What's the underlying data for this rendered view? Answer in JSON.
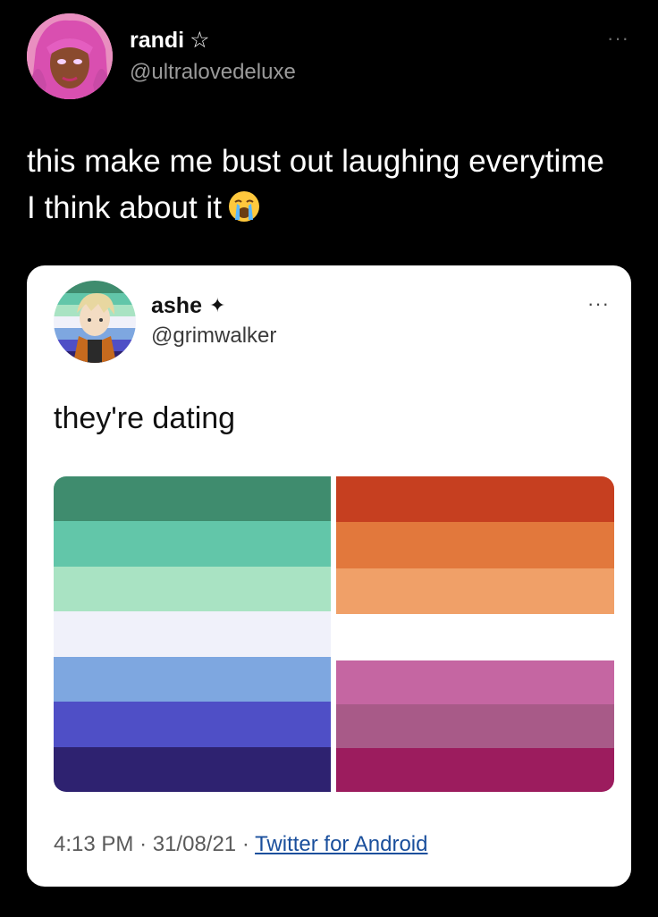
{
  "outer_tweet": {
    "display_name": "randi",
    "name_icon": "star-outline-icon",
    "handle": "@ultralovedeluxe",
    "more_icon": "more-horizontal-icon",
    "more_glyph": "···",
    "text": "this make me bust out laughing everytime I think about it",
    "emoji_icon": "loudly-crying-face-icon"
  },
  "quoted_tweet": {
    "display_name": "ashe",
    "name_icon": "sparkle-icon",
    "handle": "@grimwalker",
    "more_icon": "more-horizontal-icon",
    "more_glyph": "···",
    "text": "they're dating",
    "image": {
      "left_flag_stripes": [
        "#3f8c6e",
        "#62c6a9",
        "#a9e3c3",
        "#f0f1fa",
        "#7ea7e0",
        "#4f4fc6",
        "#2e2270"
      ],
      "right_flag_top_stripes": [
        "#c63f20",
        "#e2783c",
        "#f0a068"
      ],
      "right_flag_bottom_stripes": [
        "#c566a2",
        "#a85a88",
        "#9c1c5e"
      ]
    },
    "time": "4:13 PM",
    "separator": "·",
    "date": "31/08/21",
    "source": "Twitter for Android"
  },
  "colors": {
    "background": "#000000",
    "card": "#ffffff",
    "link": "#1a4f9c"
  }
}
